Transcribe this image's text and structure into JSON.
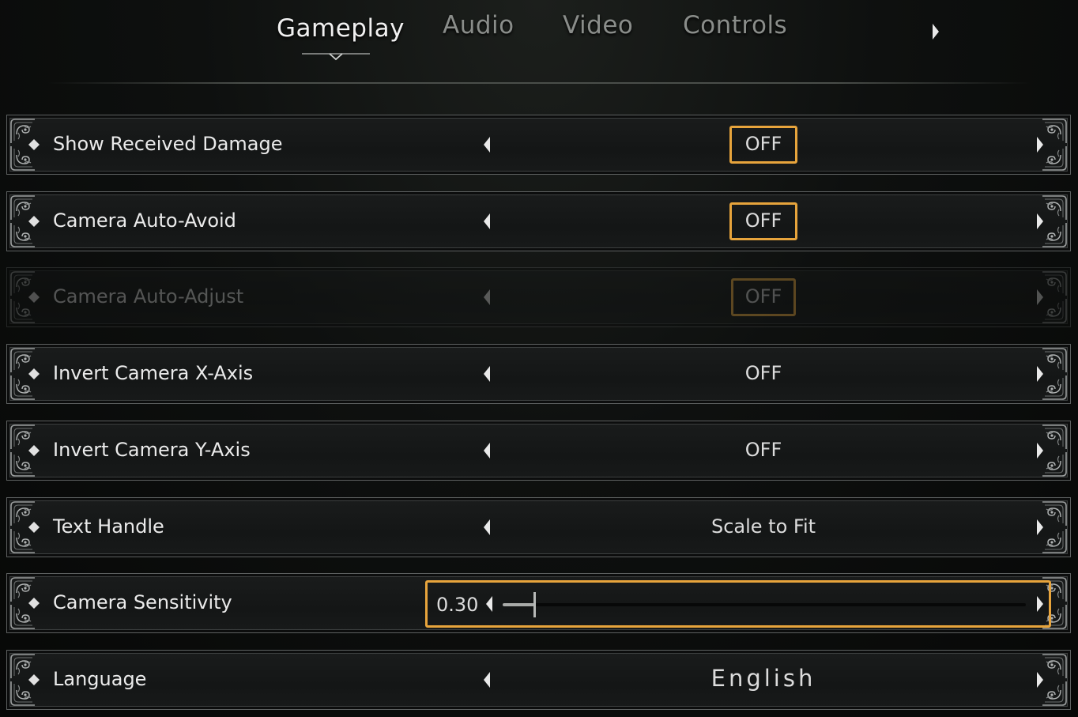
{
  "tabs": [
    {
      "label": "Gameplay",
      "active": true
    },
    {
      "label": "Audio",
      "active": false
    },
    {
      "label": "Video",
      "active": false
    },
    {
      "label": "Controls",
      "active": false
    }
  ],
  "accent_color": "#e7a43c",
  "icons": {
    "tab_next": "chevron-right-icon",
    "option_prev": "chevron-left-icon",
    "option_next": "chevron-right-icon",
    "bullet": "diamond-icon",
    "frame": "ornate-corner-icon"
  },
  "settings": [
    {
      "label": "Show Received Damage",
      "value": "OFF",
      "highlighted": true,
      "enabled": true
    },
    {
      "label": "Camera Auto-Avoid",
      "value": "OFF",
      "highlighted": true,
      "enabled": true
    },
    {
      "label": "Camera Auto-Adjust",
      "value": "OFF",
      "highlighted": true,
      "enabled": false
    },
    {
      "label": "Invert Camera X-Axis",
      "value": "OFF",
      "highlighted": false,
      "enabled": true
    },
    {
      "label": "Invert Camera Y-Axis",
      "value": "OFF",
      "highlighted": false,
      "enabled": true
    },
    {
      "label": "Text Handle",
      "value": "Scale to Fit",
      "highlighted": false,
      "enabled": true
    },
    {
      "label": "Camera Sensitivity",
      "value": "0.30",
      "slider_fraction": 0.06,
      "highlighted": true,
      "enabled": true
    },
    {
      "label": "Language",
      "value": "English",
      "highlighted": false,
      "enabled": true
    }
  ]
}
